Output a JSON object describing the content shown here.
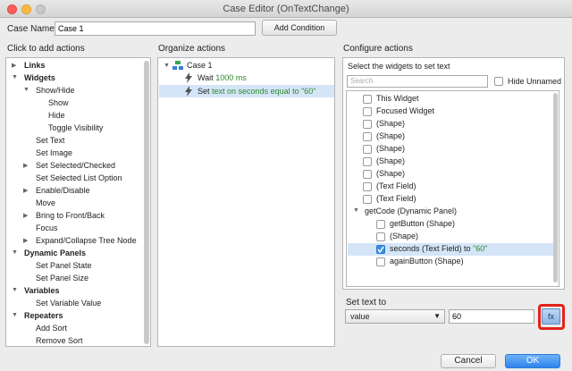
{
  "window": {
    "title": "Case Editor (OnTextChange)"
  },
  "case": {
    "label": "Case Name",
    "value": "Case 1",
    "add_condition": "Add Condition"
  },
  "sections": {
    "left": "Click to add actions",
    "middle": "Organize actions",
    "right": "Configure actions"
  },
  "actions": [
    {
      "label": "Links",
      "level": 0,
      "bold": true,
      "arrow": "right"
    },
    {
      "label": "Widgets",
      "level": 0,
      "bold": true,
      "arrow": "down"
    },
    {
      "label": "Show/Hide",
      "level": 1,
      "bold": false,
      "arrow": "down"
    },
    {
      "label": "Show",
      "level": 2,
      "bold": false,
      "arrow": ""
    },
    {
      "label": "Hide",
      "level": 2,
      "bold": false,
      "arrow": ""
    },
    {
      "label": "Toggle Visibility",
      "level": 2,
      "bold": false,
      "arrow": ""
    },
    {
      "label": "Set Text",
      "level": 1,
      "bold": false,
      "arrow": ""
    },
    {
      "label": "Set Image",
      "level": 1,
      "bold": false,
      "arrow": ""
    },
    {
      "label": "Set Selected/Checked",
      "level": 1,
      "bold": false,
      "arrow": "right"
    },
    {
      "label": "Set Selected List Option",
      "level": 1,
      "bold": false,
      "arrow": ""
    },
    {
      "label": "Enable/Disable",
      "level": 1,
      "bold": false,
      "arrow": "right"
    },
    {
      "label": "Move",
      "level": 1,
      "bold": false,
      "arrow": ""
    },
    {
      "label": "Bring to Front/Back",
      "level": 1,
      "bold": false,
      "arrow": "right"
    },
    {
      "label": "Focus",
      "level": 1,
      "bold": false,
      "arrow": ""
    },
    {
      "label": "Expand/Collapse Tree Node",
      "level": 1,
      "bold": false,
      "arrow": "right"
    },
    {
      "label": "Dynamic Panels",
      "level": 0,
      "bold": true,
      "arrow": "down"
    },
    {
      "label": "Set Panel State",
      "level": 1,
      "bold": false,
      "arrow": ""
    },
    {
      "label": "Set Panel Size",
      "level": 1,
      "bold": false,
      "arrow": ""
    },
    {
      "label": "Variables",
      "level": 0,
      "bold": true,
      "arrow": "down"
    },
    {
      "label": "Set Variable Value",
      "level": 1,
      "bold": false,
      "arrow": ""
    },
    {
      "label": "Repeaters",
      "level": 0,
      "bold": true,
      "arrow": "down"
    },
    {
      "label": "Add Sort",
      "level": 1,
      "bold": false,
      "arrow": ""
    },
    {
      "label": "Remove Sort",
      "level": 1,
      "bold": false,
      "arrow": ""
    }
  ],
  "organize": {
    "case_label": "Case 1",
    "wait": {
      "prefix": "Wait",
      "value": "1000 ms"
    },
    "set": {
      "prefix": "Set",
      "value": "text on seconds equal to \"60\""
    }
  },
  "configure": {
    "select_label": "Select the widgets to set text",
    "search_placeholder": "Search",
    "hide_unnamed": "Hide Unnamed",
    "widgets": [
      {
        "label": "This Widget",
        "checked": false,
        "indent": 1,
        "type": "item"
      },
      {
        "label": "Focused Widget",
        "checked": false,
        "indent": 1,
        "type": "item"
      },
      {
        "label": "(Shape)",
        "checked": false,
        "indent": 1,
        "type": "item"
      },
      {
        "label": "(Shape)",
        "checked": false,
        "indent": 1,
        "type": "item"
      },
      {
        "label": "(Shape)",
        "checked": false,
        "indent": 1,
        "type": "item"
      },
      {
        "label": "(Shape)",
        "checked": false,
        "indent": 1,
        "type": "item"
      },
      {
        "label": "(Shape)",
        "checked": false,
        "indent": 1,
        "type": "item"
      },
      {
        "label": "(Text Field)",
        "checked": false,
        "indent": 1,
        "type": "item"
      },
      {
        "label": "(Text Field)",
        "checked": false,
        "indent": 1,
        "type": "item"
      },
      {
        "label": "getCode (Dynamic Panel)",
        "checked": false,
        "indent": 0,
        "type": "group"
      },
      {
        "label": "getButton (Shape)",
        "checked": false,
        "indent": 2,
        "type": "item"
      },
      {
        "label": "(Shape)",
        "checked": false,
        "indent": 2,
        "type": "item"
      },
      {
        "label": "seconds (Text Field) to ",
        "suffix": "\"60\"",
        "checked": true,
        "indent": 2,
        "type": "item",
        "selected": true
      },
      {
        "label": "againButton (Shape)",
        "checked": false,
        "indent": 2,
        "type": "item"
      }
    ],
    "set_text_to": "Set text to",
    "value_type": "value",
    "value": "60",
    "fx": "fx"
  },
  "footer": {
    "cancel": "Cancel",
    "ok": "OK"
  },
  "colors": {
    "accent": "#2d83ec",
    "highlight": "#e2231a",
    "selection": "#d5e5f8",
    "value_green": "#2d8a2d"
  }
}
